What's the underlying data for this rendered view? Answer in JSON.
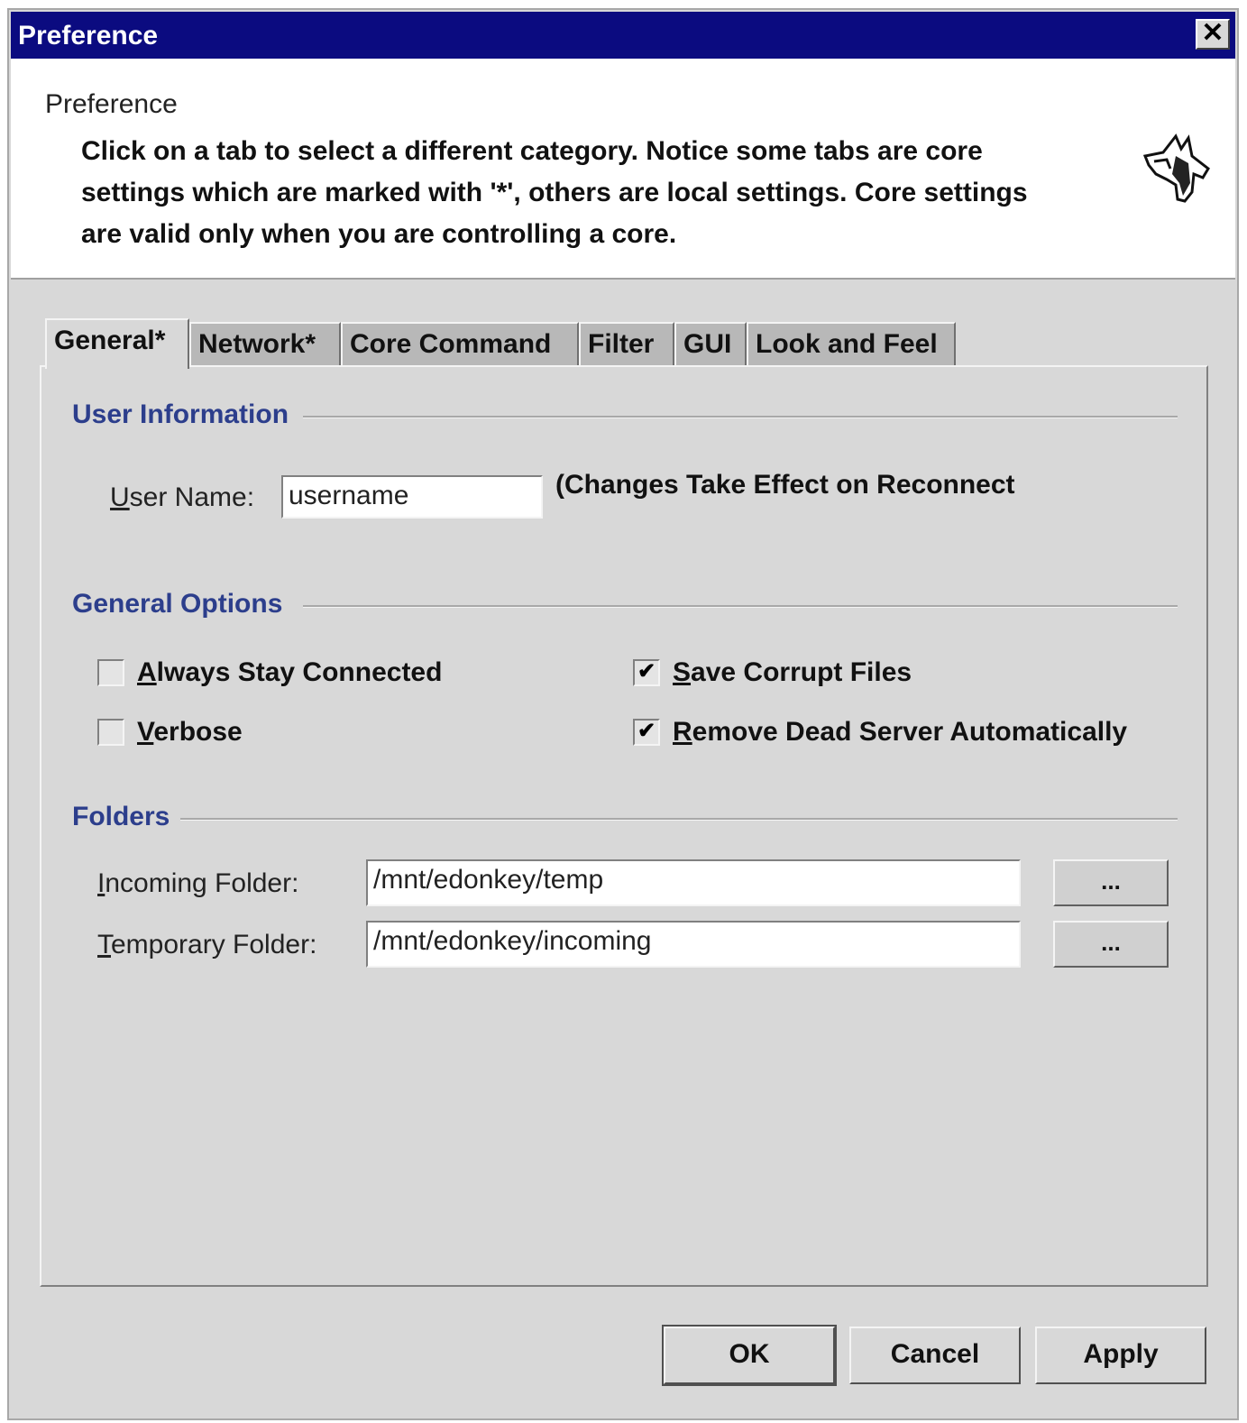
{
  "window": {
    "title": "Preference",
    "close_glyph": "✕"
  },
  "header": {
    "title": "Preference",
    "description": "Click on a tab to select a different category. Notice some tabs are core settings which are marked with '*', others are local settings. Core settings are valid only when you are controlling a core.",
    "icon": "donkey-logo-icon"
  },
  "tabs": [
    {
      "label": "General*",
      "active": true
    },
    {
      "label": "Network*",
      "active": false
    },
    {
      "label": "Core Command",
      "active": false
    },
    {
      "label": "Filter",
      "active": false
    },
    {
      "label": "GUI",
      "active": false
    },
    {
      "label": "Look and Feel",
      "active": false
    }
  ],
  "user_info": {
    "section_title": "User Information",
    "user_name_label_mnemonic": "U",
    "user_name_label_rest": "ser Name:",
    "user_name_value": "username",
    "note": "(Changes Take Effect on Reconnect"
  },
  "general_options": {
    "section_title": "General Options",
    "always_connected": {
      "mnemonic": "A",
      "rest": "lways Stay Connected",
      "checked": false
    },
    "verbose": {
      "mnemonic": "V",
      "rest": "erbose",
      "checked": false
    },
    "save_corrupt": {
      "mnemonic": "S",
      "rest": "ave Corrupt Files",
      "checked": true
    },
    "remove_dead": {
      "mnemonic": "R",
      "rest": "emove Dead Server Automatically",
      "checked": true
    }
  },
  "folders": {
    "section_title": "Folders",
    "incoming_label_mnemonic": "I",
    "incoming_label_rest": "ncoming Folder:",
    "incoming_value": "/mnt/edonkey/temp",
    "temporary_label_mnemonic": "T",
    "temporary_label_rest": "emporary Folder:",
    "temporary_value": "/mnt/edonkey/incoming",
    "browse_label": "..."
  },
  "buttons": {
    "ok": "OK",
    "cancel": "Cancel",
    "apply": "Apply"
  },
  "colors": {
    "titlebar": "#0b0b80",
    "section_title": "#2c3e8c",
    "panel": "#d8d8d8"
  }
}
